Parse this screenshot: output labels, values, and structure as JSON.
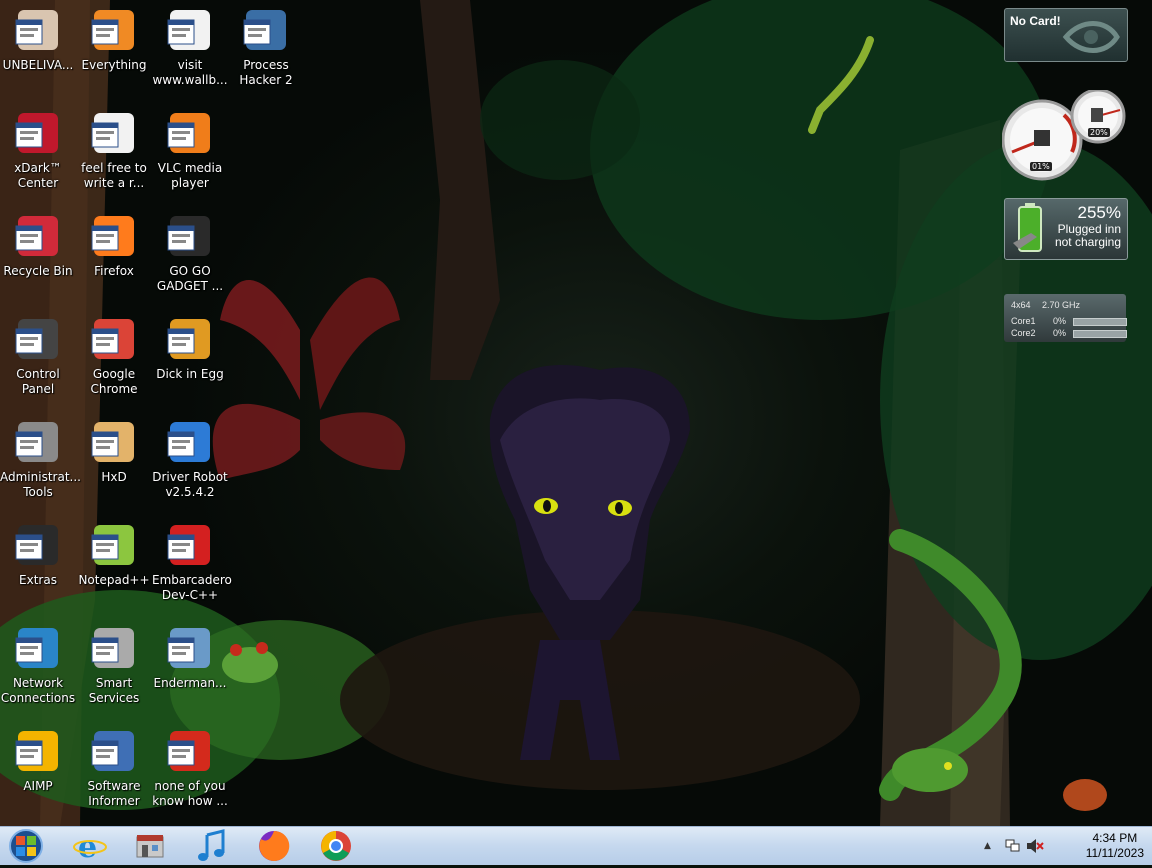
{
  "desktop": {
    "icons": [
      {
        "label": "UNBELIVA...",
        "icon": "anime-girl-icon"
      },
      {
        "label": "Everything",
        "icon": "everything-search-icon"
      },
      {
        "label": "visit\nwww.wallb...",
        "icon": "text-document-icon"
      },
      {
        "label": "Process\nHacker 2",
        "icon": "process-hacker-icon"
      },
      {
        "label": "xDark™\nCenter",
        "icon": "red-flower-icon"
      },
      {
        "label": "feel free to\nwrite a r...",
        "icon": "text-document-icon"
      },
      {
        "label": "VLC media\nplayer",
        "icon": "vlc-cone-icon"
      },
      {
        "label": "Recycle Bin",
        "icon": "recycle-flower-icon"
      },
      {
        "label": "Firefox",
        "icon": "firefox-icon"
      },
      {
        "label": "GO GO\nGADGET ...",
        "icon": "black-box-icon"
      },
      {
        "label": "Control Panel",
        "icon": "control-panel-icon"
      },
      {
        "label": "Google\nChrome",
        "icon": "chrome-icon"
      },
      {
        "label": "Dick in Egg",
        "icon": "egg-e-icon"
      },
      {
        "label": "Administrat...\nTools",
        "icon": "gears-icon"
      },
      {
        "label": "HxD",
        "icon": "hxd-icon"
      },
      {
        "label": "Driver Robot\nv2.5.4.2",
        "icon": "driver-robot-icon"
      },
      {
        "label": "Extras",
        "icon": "black-box-icon"
      },
      {
        "label": "Notepad++",
        "icon": "notepad-plus-icon"
      },
      {
        "label": "Embarcadero\nDev-C++",
        "icon": "devcpp-icon"
      },
      {
        "label": "Network\nConnections",
        "icon": "globe-network-icon"
      },
      {
        "label": "Smart\nServices",
        "icon": "smart-services-icon"
      },
      {
        "label": "Enderman...",
        "icon": "window-app-icon"
      },
      {
        "label": "AIMP",
        "icon": "aimp-icon"
      },
      {
        "label": "Software\nInformer",
        "icon": "software-informer-icon"
      },
      {
        "label": "none of you\nknow how ...",
        "icon": "red-circle-icon"
      }
    ]
  },
  "gadgets": {
    "gpu": {
      "text": "No Card!"
    },
    "meter": {
      "cpu": "01%",
      "ram": "20%"
    },
    "battery": {
      "percent": "255%",
      "line1": "Plugged inn",
      "line2": "not charging"
    },
    "cpu": {
      "arch": "4x64",
      "speed": "2.70 GHz",
      "cores": [
        {
          "name": "Core1",
          "value": "0%",
          "level": 0
        },
        {
          "name": "Core2",
          "value": "0%",
          "level": 0
        }
      ]
    }
  },
  "taskbar": {
    "apps": [
      {
        "icon": "internet-explorer-icon"
      },
      {
        "icon": "store-icon"
      },
      {
        "icon": "music-note-icon"
      },
      {
        "icon": "firefox-icon"
      },
      {
        "icon": "chrome-icon"
      }
    ],
    "tray_arrow": "▲",
    "time": "4:34 PM",
    "date": "11/11/2023"
  },
  "colors": {
    "taskbar": "#c5d8ee",
    "battery_green": "#4caf2a",
    "chrome_red": "#db4437",
    "chrome_green": "#0f9d58",
    "chrome_yellow": "#f4b400",
    "chrome_blue": "#4285f4"
  }
}
